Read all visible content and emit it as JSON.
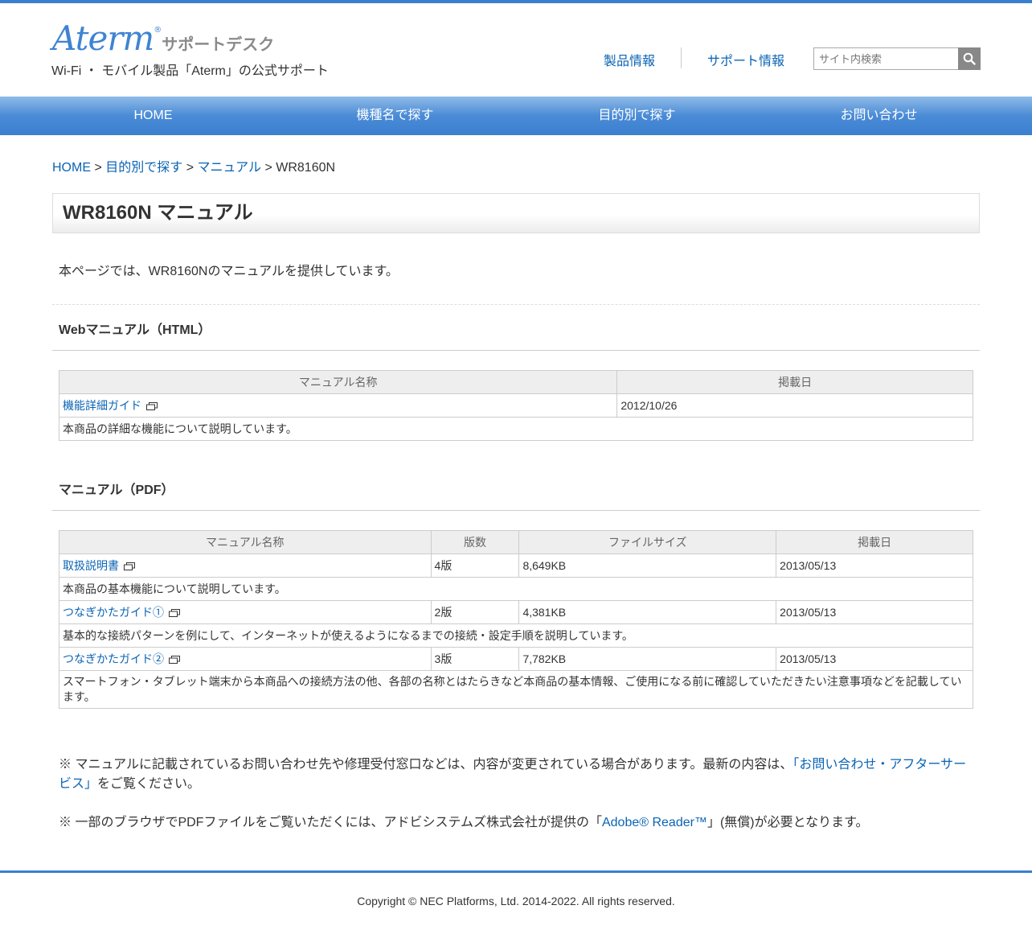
{
  "header": {
    "logo_text": "Aterm",
    "logo_reg": "®",
    "logo_sub": "サポートデスク",
    "tagline": "Wi-Fi ・ モバイル製品「Aterm」の公式サポート",
    "link_products": "製品情報",
    "link_support": "サポート情報",
    "search_placeholder": "サイト内検索",
    "search_icon": "search-icon"
  },
  "nav": {
    "items": [
      "HOME",
      "機種名で探す",
      "目的別で探す",
      "お問い合わせ"
    ]
  },
  "breadcrumb": {
    "home": "HOME",
    "sep1": " > ",
    "purpose": "目的別で探す",
    "sep2": " > ",
    "manual": "マニュアル",
    "sep3": " > ",
    "current": "WR8160N"
  },
  "page": {
    "title": "WR8160N マニュアル",
    "intro": "本ページでは、WR8160Nのマニュアルを提供しています。"
  },
  "web_manual": {
    "heading": "Webマニュアル（HTML）",
    "headers": [
      "マニュアル名称",
      "掲載日"
    ],
    "rows": [
      {
        "name": "機能詳細ガイド",
        "date": "2012/10/26",
        "desc": "本商品の詳細な機能について説明しています。"
      }
    ]
  },
  "pdf_manual": {
    "heading": "マニュアル（PDF）",
    "headers": [
      "マニュアル名称",
      "版数",
      "ファイルサイズ",
      "掲載日"
    ],
    "rows": [
      {
        "name": "取扱説明書",
        "edition": "4版",
        "size": "8,649KB",
        "date": "2013/05/13",
        "desc": "本商品の基本機能について説明しています。"
      },
      {
        "name": "つなぎかたガイド①",
        "edition": "2版",
        "size": "4,381KB",
        "date": "2013/05/13",
        "desc": "基本的な接続パターンを例にして、インターネットが使えるようになるまでの接続・設定手順を説明しています。"
      },
      {
        "name": "つなぎかたガイド②",
        "edition": "3版",
        "size": "7,782KB",
        "date": "2013/05/13",
        "desc": "スマートフォン・タブレット端末から本商品への接続方法の他、各部の名称とはたらきなど本商品の基本情報、ご使用になる前に確認していただきたい注意事項などを記載しています。"
      }
    ]
  },
  "notes": {
    "note1_pre": "※ マニュアルに記載されているお問い合わせ先や修理受付窓口などは、内容が変更されている場合があります。最新の内容は、",
    "note1_link": "「お問い合わせ・アフターサービス」",
    "note1_post": "をご覧ください。",
    "note2_pre": "※ 一部のブラウザでPDFファイルをご覧いただくには、アドビシステムズ株式会社が提供の「",
    "note2_link": "Adobe® Reader™",
    "note2_post": "」(無償)が必要となります。"
  },
  "footer": {
    "copyright": "Copyright © NEC Platforms, Ltd. 2014-2022. All rights reserved."
  },
  "colors": {
    "accent": "#3a7fcf",
    "link": "#0a64b4"
  }
}
